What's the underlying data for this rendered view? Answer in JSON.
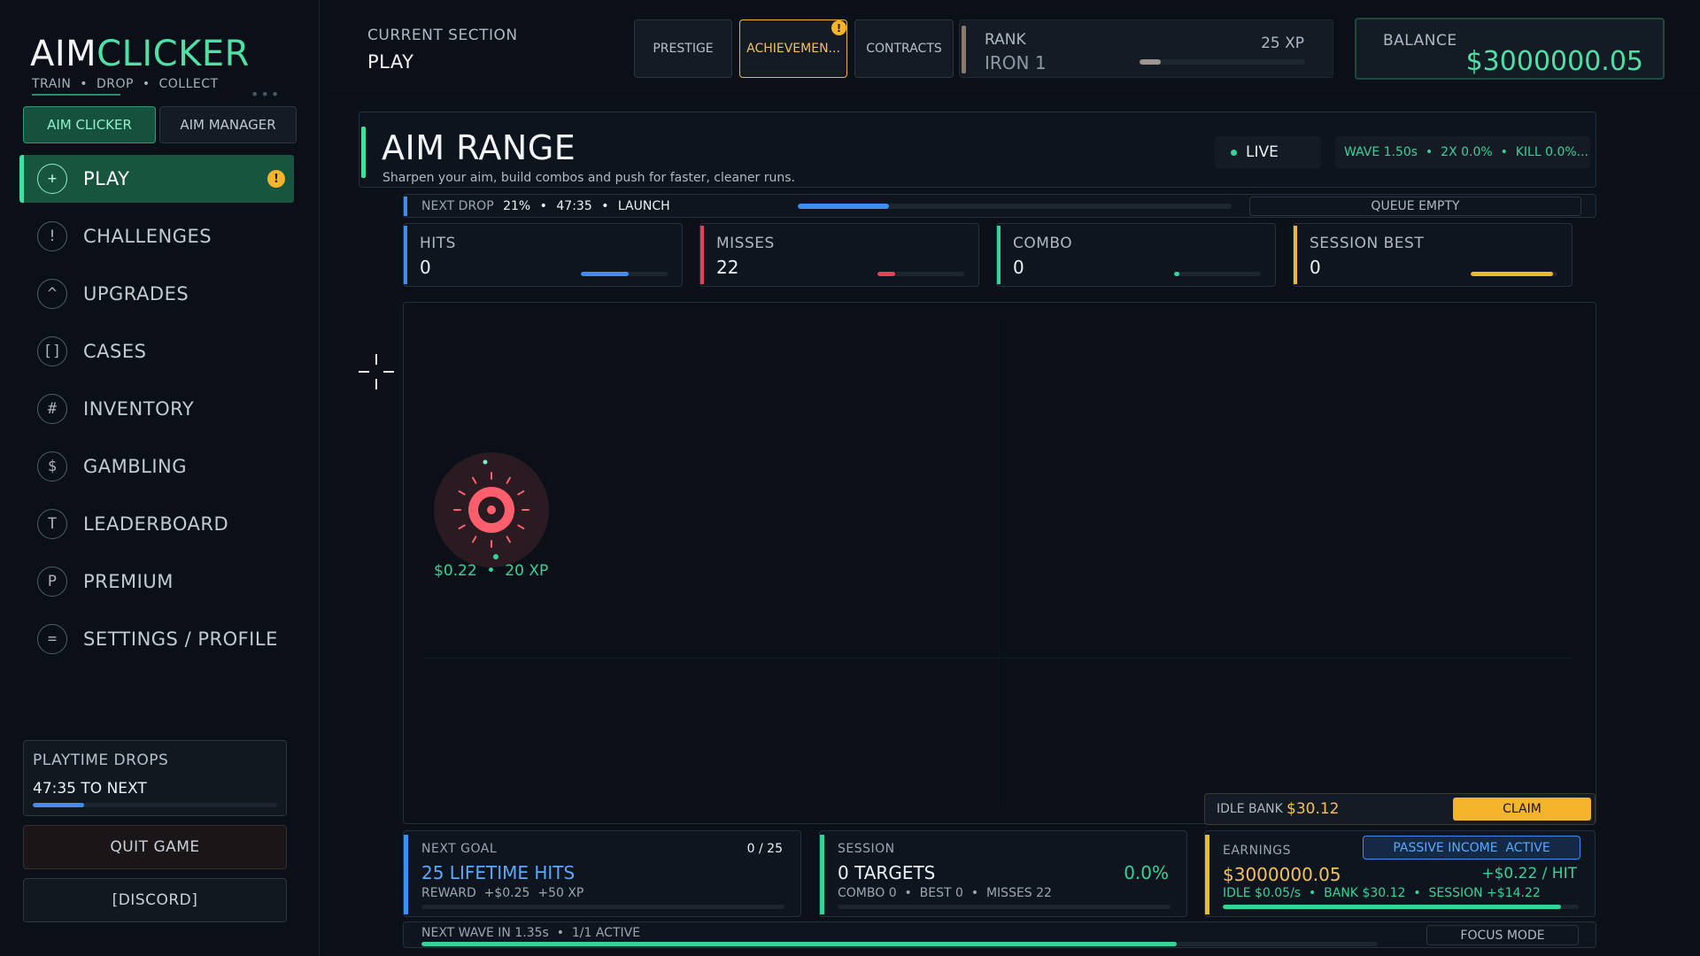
{
  "app": {
    "logo_part1": "AIM",
    "logo_part2": "CLICKER",
    "tagline": "TRAIN  •  DROP  •  COLLECT"
  },
  "sidebar": {
    "mode_tabs": [
      {
        "label": "AIM CLICKER"
      },
      {
        "label": "AIM MANAGER"
      }
    ],
    "items": [
      {
        "icon": "+",
        "label": "PLAY"
      },
      {
        "icon": "!",
        "label": "CHALLENGES"
      },
      {
        "icon": "^",
        "label": "UPGRADES"
      },
      {
        "icon": "[]",
        "label": "CASES"
      },
      {
        "icon": "#",
        "label": "INVENTORY"
      },
      {
        "icon": "$",
        "label": "GAMBLING"
      },
      {
        "icon": "T",
        "label": "LEADERBOARD"
      },
      {
        "icon": "P",
        "label": "PREMIUM"
      },
      {
        "icon": "=",
        "label": "SETTINGS / PROFILE"
      }
    ],
    "active_badge": "!",
    "playtime": {
      "title": "PLAYTIME DROPS",
      "next": "47:35 TO NEXT",
      "progress": 0.21
    },
    "quit_label": "QUIT GAME",
    "discord_label": "[DISCORD]"
  },
  "header": {
    "section_label": "CURRENT SECTION",
    "section_value": "PLAY",
    "tabs": [
      {
        "label": "PRESTIGE"
      },
      {
        "label": "ACHIEVEMEN..."
      },
      {
        "label": "CONTRACTS"
      }
    ],
    "achievement_badge": "!",
    "rank": {
      "label": "RANK",
      "value": "IRON 1",
      "xp": "25 XP",
      "progress": 0.13
    },
    "balance": {
      "label": "BALANCE",
      "value": "$3000000.05"
    }
  },
  "range": {
    "title": "AIM RANGE",
    "subtitle": "Sharpen your aim, build combos and push for faster, cleaner runs.",
    "live_label": "LIVE",
    "wave_info": "WAVE 1.50s  •  2X 0.0%  •  KILL 0.0%...",
    "next_drop": {
      "label": "NEXT DROP",
      "percent": "21%",
      "time": "47:35",
      "action": "LAUNCH",
      "progress": 0.21
    },
    "queue_label": "QUEUE EMPTY",
    "stats": [
      {
        "label": "HITS",
        "value": "0",
        "color": "#3d8ef0",
        "fill": 0.55
      },
      {
        "label": "MISSES",
        "value": "22",
        "color": "#e6405a",
        "fill": 0.2
      },
      {
        "label": "COMBO",
        "value": "0",
        "color": "#35d39a",
        "fill": 0.06
      },
      {
        "label": "SESSION BEST",
        "value": "0",
        "color": "#f3b52b",
        "fill": 0.95
      }
    ],
    "target_reward": "$0.22  •  20 XP",
    "idle_bank": {
      "label": "IDLE BANK",
      "value": "$30.12",
      "claim_label": "CLAIM"
    }
  },
  "bottom": {
    "goal": {
      "label": "NEXT GOAL",
      "count": "0 / 25",
      "title": "25 LIFETIME HITS",
      "reward": "REWARD  +$0.25  +50 XP",
      "progress": 0.0
    },
    "session": {
      "label": "SESSION",
      "title": "0 TARGETS",
      "accuracy": "0.0%",
      "details": "COMBO 0  •  BEST 0  •  MISSES 22"
    },
    "earnings": {
      "label": "EARNINGS",
      "badge": "PASSIVE INCOME  ACTIVE",
      "value": "$3000000.05",
      "per_hit": "+$0.22 / HIT",
      "details": "IDLE $0.05/s  •  BANK $30.12  •  SESSION +$14.22",
      "progress": 0.95
    },
    "wave": {
      "label": "NEXT WAVE IN 1.35s  •  1/1 ACTIVE",
      "progress": 0.79,
      "focus_label": "FOCUS MODE"
    }
  },
  "colors": {
    "accent": "#35d39a",
    "gold": "#f3b52b",
    "blue": "#3d8ef0",
    "red": "#e6405a",
    "target": "#ff5e6c"
  }
}
